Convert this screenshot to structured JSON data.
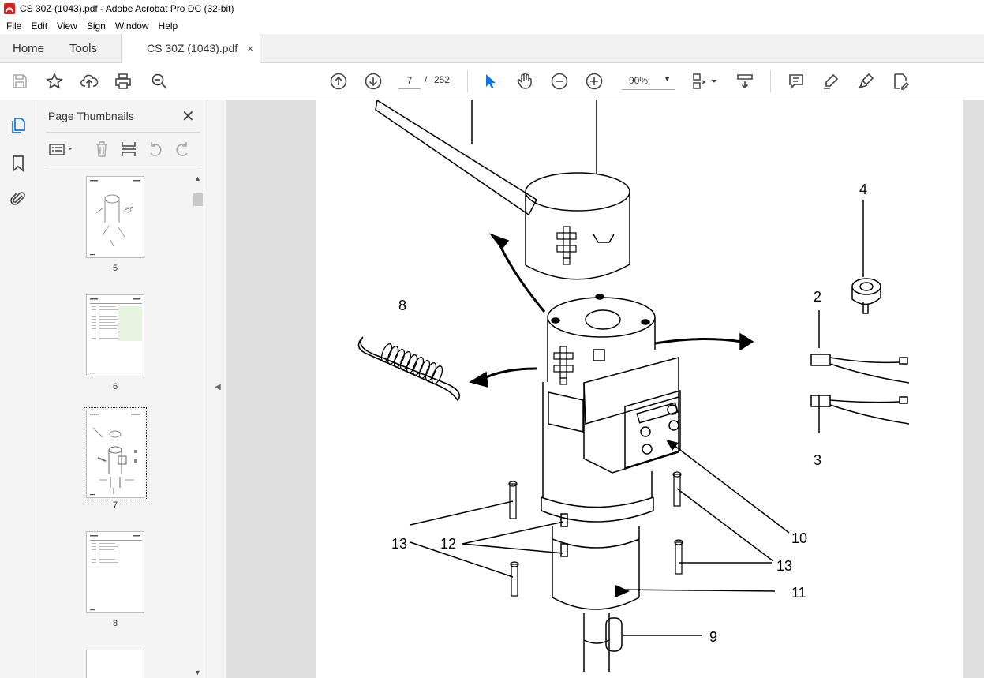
{
  "window": {
    "title": "CS 30Z (1043).pdf - Adobe Acrobat Pro DC (32-bit)"
  },
  "menu": [
    "File",
    "Edit",
    "View",
    "Sign",
    "Window",
    "Help"
  ],
  "tabs": {
    "home": "Home",
    "tools": "Tools",
    "document": "CS 30Z (1043).pdf",
    "close": "×"
  },
  "toolbar": {
    "page_current": "7",
    "page_separator": "/",
    "page_total": "252",
    "zoom": "90%",
    "icons": [
      "save-icon",
      "star-icon",
      "upload-icon",
      "print-icon",
      "zoom-search-icon",
      "page-up-icon",
      "page-down-icon",
      "select-cursor-icon",
      "hand-icon",
      "zoom-out-icon",
      "zoom-in-icon",
      "fit-page-icon",
      "scroll-mode-icon",
      "comment-icon",
      "highlight-icon",
      "sign-icon",
      "edit-pdf-icon"
    ]
  },
  "panel": {
    "title": "Page Thumbnails",
    "close": "✕",
    "thumbnails": [
      {
        "label": "5",
        "selected": false
      },
      {
        "label": "6",
        "selected": false
      },
      {
        "label": "7",
        "selected": true
      },
      {
        "label": "8",
        "selected": false
      }
    ]
  },
  "drawing": {
    "callouts": [
      "4",
      "2",
      "8",
      "3",
      "10",
      "13",
      "12",
      "13",
      "11",
      "9"
    ]
  },
  "colors": {
    "accent": "#1473e6",
    "toolbar_bg": "#ffffff",
    "panel_bg": "#f4f4f4",
    "doc_bg": "#dedede"
  }
}
